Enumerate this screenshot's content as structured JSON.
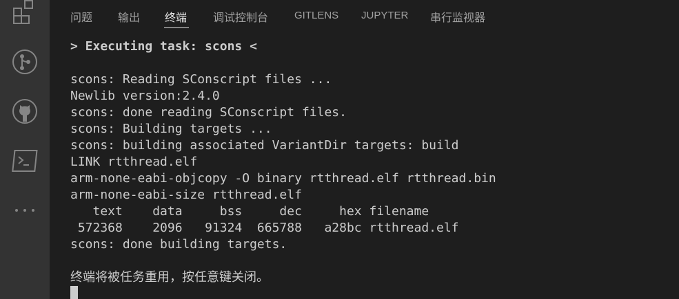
{
  "activity_bar": {
    "icons": [
      "extensions-icon",
      "source-control-icon",
      "github-icon",
      "terminal-icon",
      "more-icon"
    ]
  },
  "panel_tabs": [
    {
      "label": "问题"
    },
    {
      "label": "输出"
    },
    {
      "label": "终端",
      "active": true
    },
    {
      "label": "调试控制台"
    },
    {
      "label": "GITLENS"
    },
    {
      "label": "JUPYTER"
    },
    {
      "label": "串行监视器"
    }
  ],
  "terminal": {
    "task_header": "> Executing task: scons <",
    "lines": [
      "scons: Reading SConscript files ...",
      "Newlib version:2.4.0",
      "scons: done reading SConscript files.",
      "scons: Building targets ...",
      "scons: building associated VariantDir targets: build",
      "LINK rtthread.elf",
      "arm-none-eabi-objcopy -O binary rtthread.elf rtthread.bin",
      "arm-none-eabi-size rtthread.elf",
      "   text    data     bss     dec     hex filename",
      " 572368    2096   91324  665788   a28bc rtthread.elf",
      "scons: done building targets."
    ],
    "footer": "终端将被任务重用，按任意键关闭。"
  },
  "colors": {
    "background": "#1e1e1e",
    "activity_bar": "#333333",
    "text": "#cccccc",
    "tab_inactive": "#a0a0a0",
    "tab_active": "#e7e7e7"
  }
}
